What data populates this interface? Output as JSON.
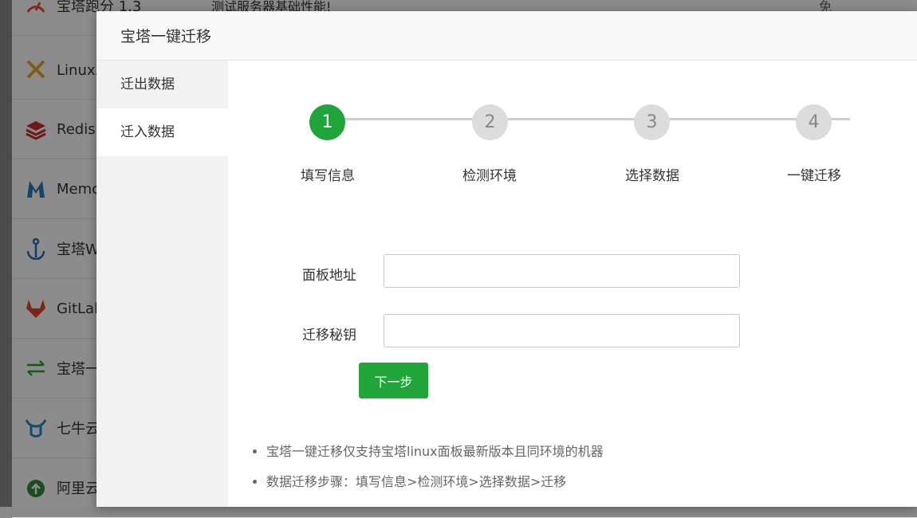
{
  "background_list": {
    "rows": [
      {
        "name": "宝塔跑分 1.3",
        "desc": "测试服务器基础性能!",
        "free": "免",
        "icon": "gauge-icon",
        "color": "#e8503a"
      },
      {
        "name": "Linux工",
        "desc": "",
        "free": "",
        "icon": "wrench-screwdriver-icon",
        "color": "#f0a22a"
      },
      {
        "name": "Redis",
        "desc": "",
        "free": "",
        "icon": "redis-icon",
        "color": "#c6302b"
      },
      {
        "name": "Memc",
        "desc": "",
        "free": "",
        "icon": "memcached-icon",
        "color": "#2a7ab8"
      },
      {
        "name": "宝塔W",
        "desc": "",
        "free": "",
        "icon": "anchor-icon",
        "color": "#1e6fc2"
      },
      {
        "name": "GitLab",
        "desc": "",
        "free": "",
        "icon": "gitlab-icon",
        "color": "#e24329"
      },
      {
        "name": "宝塔一",
        "desc": "",
        "free": "",
        "icon": "transfer-arrows-icon",
        "color": "#20a53a"
      },
      {
        "name": "七牛云",
        "desc": "",
        "free": "",
        "icon": "qiniu-icon",
        "color": "#1a8ed1"
      },
      {
        "name": "阿里云",
        "desc": "",
        "free": "",
        "icon": "aliyun-icon",
        "color": "#2e8b3a"
      }
    ]
  },
  "modal": {
    "title": "宝塔一键迁移",
    "nav": [
      {
        "label": "迁出数据",
        "active": false
      },
      {
        "label": "迁入数据",
        "active": true
      }
    ],
    "steps": [
      {
        "num": "1",
        "label": "填写信息",
        "active": true
      },
      {
        "num": "2",
        "label": "检测环境",
        "active": false
      },
      {
        "num": "3",
        "label": "选择数据",
        "active": false
      },
      {
        "num": "4",
        "label": "一键迁移",
        "active": false
      }
    ],
    "form": {
      "panel_address_label": "面板地址",
      "panel_address_value": "",
      "migrate_key_label": "迁移秘钥",
      "migrate_key_value": "",
      "next_button": "下一步"
    },
    "notes": [
      "宝塔一键迁移仅支持宝塔linux面板最新版本且同环境的机器",
      "数据迁移步骤：填写信息>检测环境>选择数据>迁移"
    ],
    "accent_color": "#20a53a"
  }
}
